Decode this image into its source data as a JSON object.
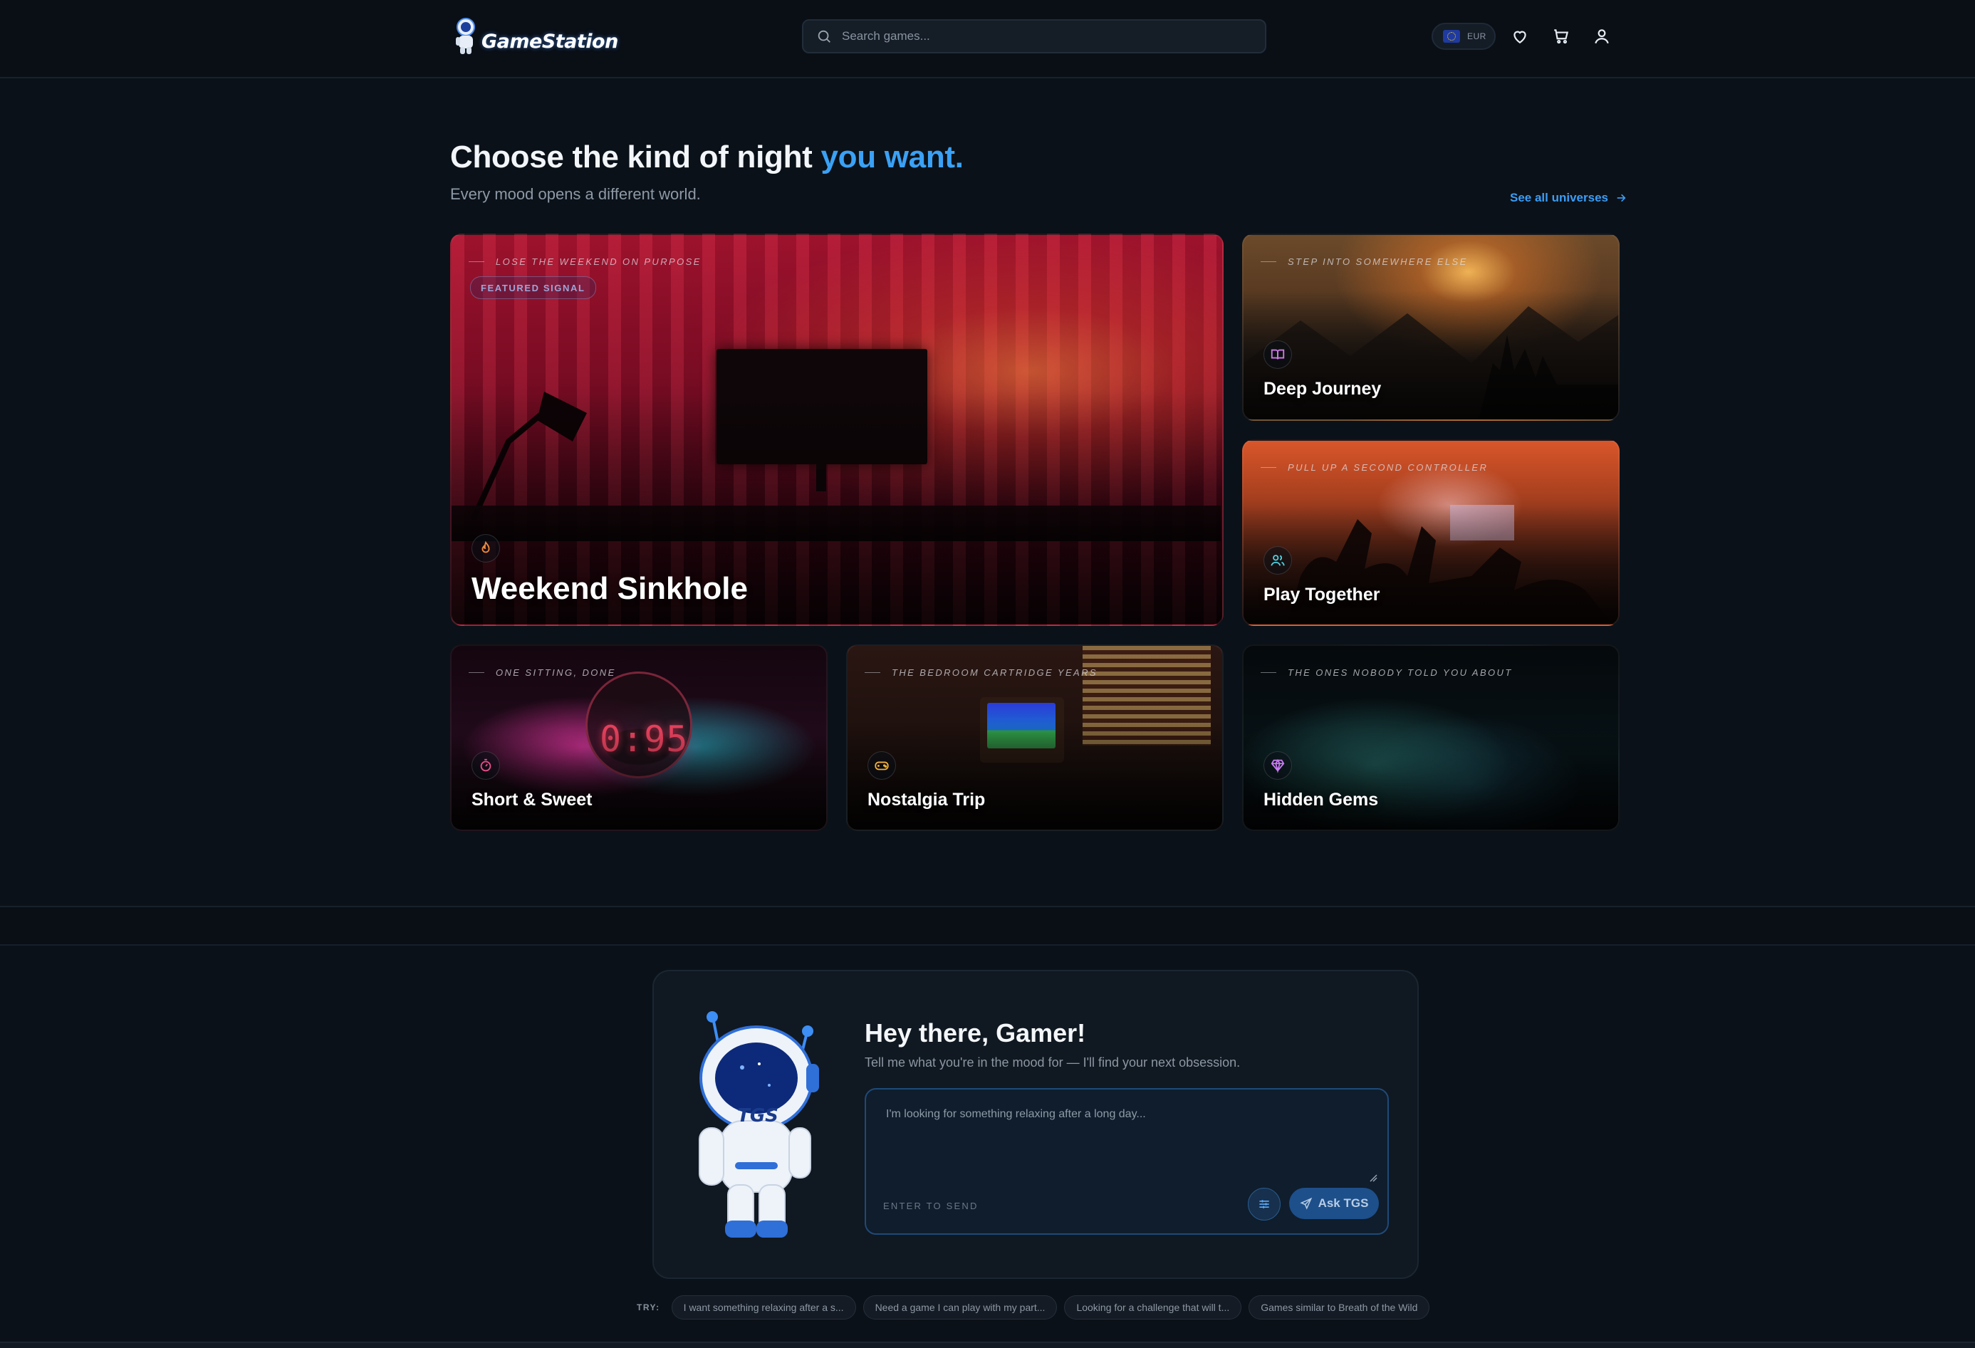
{
  "header": {
    "brand": "GameStation",
    "search_placeholder": "Search games...",
    "currency": "EUR",
    "icons": [
      "search-icon",
      "eu-flag-icon",
      "heart-icon",
      "cart-icon",
      "user-icon"
    ]
  },
  "hero": {
    "headline_main": "Choose the kind of night ",
    "headline_accent": "you want.",
    "subtitle": "Every mood opens a different world.",
    "see_all": "See all universes",
    "accent_color": "#3aa1f5"
  },
  "moods": [
    {
      "eyebrow": "LOSE THE WEEKEND ON PURPOSE",
      "badge": "FEATURED SIGNAL",
      "title": "Weekend Sinkhole",
      "icon": "flame-icon"
    },
    {
      "eyebrow": "STEP INTO SOMEWHERE ELSE",
      "title": "Deep Journey",
      "icon": "book-open-icon"
    },
    {
      "eyebrow": "PULL UP A SECOND CONTROLLER",
      "title": "Play Together",
      "icon": "users-icon"
    },
    {
      "eyebrow": "ONE SITTING, DONE",
      "title": "Short & Sweet",
      "icon": "timer-icon",
      "timer": "0:95"
    },
    {
      "eyebrow": "THE BEDROOM CARTRIDGE YEARS",
      "title": "Nostalgia Trip",
      "icon": "gamepad-icon"
    },
    {
      "eyebrow": "THE ONES NOBODY TOLD YOU ABOUT",
      "title": "Hidden Gems",
      "icon": "gem-icon"
    }
  ],
  "assistant": {
    "mascot_label": "TGS",
    "title": "Hey there, Gamer!",
    "subtitle": "Tell me what you're in the mood for — I'll find your next obsession.",
    "input_placeholder": "I'm looking for something relaxing after a long day...",
    "enter_hint": "ENTER TO SEND",
    "ask_label": "Ask TGS",
    "try_label": "TRY:",
    "suggestions": [
      "I want something relaxing after a s...",
      "Need a game I can play with my part...",
      "Looking for a challenge that will t...",
      "Games similar to Breath of the Wild"
    ]
  }
}
